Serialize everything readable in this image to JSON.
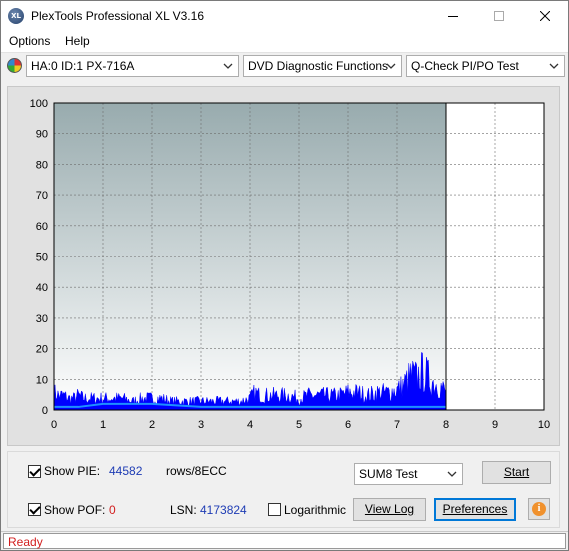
{
  "window": {
    "title": "PlexTools Professional XL V3.16",
    "icon_label": "XL"
  },
  "menu": {
    "options": "Options",
    "help": "Help"
  },
  "toolbar": {
    "drive": "HA:0 ID:1  PX-716A",
    "function": "DVD Diagnostic Functions",
    "test": "Q-Check PI/PO Test"
  },
  "chart_data": {
    "type": "area",
    "x_ticks": [
      "0",
      "1",
      "2",
      "3",
      "4",
      "5",
      "6",
      "7",
      "8",
      "9",
      "10"
    ],
    "y_ticks": [
      "0",
      "10",
      "20",
      "30",
      "40",
      "50",
      "60",
      "70",
      "80",
      "90",
      "100"
    ],
    "xlim": [
      0,
      10
    ],
    "ylim": [
      0,
      100
    ],
    "end_marker_x": 8.0,
    "grid": true,
    "colors": {
      "pie": "#0000ff",
      "sum8": "#1e90ff",
      "plot_top": "#98abae",
      "plot_bottom": "#ffffff"
    },
    "series": [
      {
        "x": [
          0.0,
          0.1,
          0.2,
          0.3,
          0.4,
          0.5,
          0.6,
          0.7,
          0.8,
          0.9,
          1.0,
          1.2,
          1.4,
          1.6,
          1.8,
          2.0,
          2.2,
          2.4,
          2.6,
          2.8,
          3.0,
          3.2,
          3.4,
          3.6,
          3.8,
          4.0,
          4.1,
          4.2,
          4.4,
          4.6,
          4.8,
          5.0,
          5.2,
          5.4,
          5.6,
          5.8,
          6.0,
          6.2,
          6.4,
          6.6,
          6.8,
          7.0,
          7.1,
          7.2,
          7.3,
          7.4,
          7.5,
          7.6,
          7.7,
          7.8,
          7.9,
          8.0
        ],
        "values": [
          6,
          5,
          5,
          4,
          4,
          5,
          4,
          4,
          4,
          4,
          4,
          4,
          4,
          3,
          4,
          4,
          4,
          3,
          3,
          3,
          3,
          3,
          3,
          3,
          3,
          4,
          6,
          5,
          5,
          5,
          5,
          4,
          5,
          5,
          5,
          5,
          6,
          6,
          5,
          6,
          6,
          7,
          8,
          10,
          12,
          11,
          13,
          12,
          10,
          9,
          8,
          6
        ]
      },
      {
        "x": [
          0.0,
          0.5,
          1.0,
          2.0,
          3.0,
          4.0,
          5.0,
          6.0,
          7.0,
          8.0
        ],
        "values": [
          1,
          1,
          2,
          2,
          1,
          1,
          1,
          1,
          1,
          1
        ]
      }
    ]
  },
  "bottom": {
    "show_pie_label": "Show PIE:",
    "pie_value": "44582",
    "unit": "rows/8ECC",
    "show_pof_label": "Show POF:",
    "pof_value": "0",
    "lsn_label": "LSN:",
    "lsn_value": "4173824",
    "log_label": "Logarithmic",
    "sum_select": "SUM8 Test",
    "start_btn": "Start",
    "viewlog_btn": "View Log",
    "prefs_btn": "Preferences",
    "info_glyph": "i"
  },
  "status": {
    "text": "Ready"
  }
}
